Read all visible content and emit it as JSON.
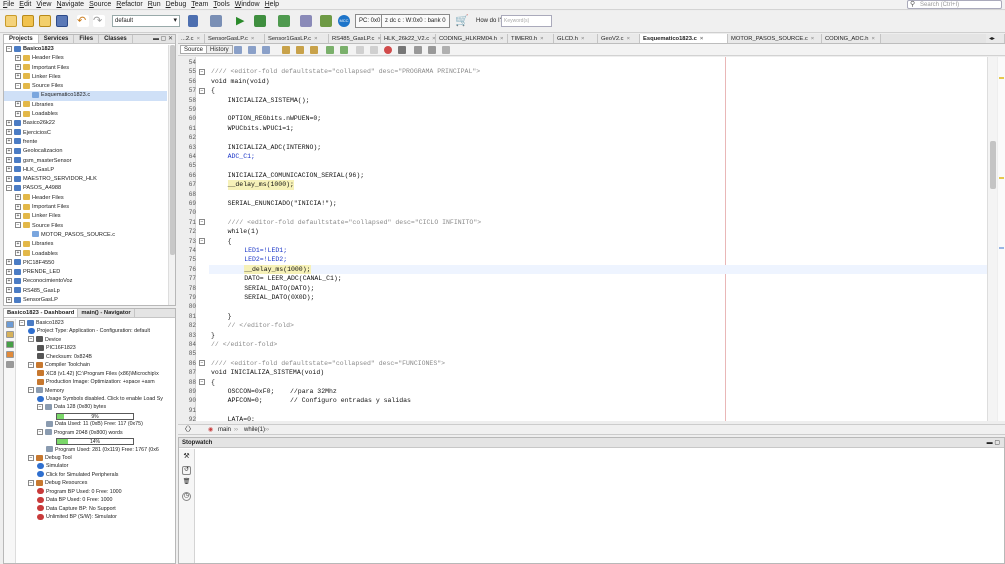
{
  "menu": [
    "File",
    "Edit",
    "View",
    "Navigate",
    "Source",
    "Refactor",
    "Run",
    "Debug",
    "Team",
    "Tools",
    "Window",
    "Help"
  ],
  "search_placeholder": "Search (Ctrl+I)",
  "toolbar": {
    "config_value": "default",
    "pc_label": "PC: 0x0",
    "status_bits": "z dc c  : W:0x0 : bank 0",
    "how_do_i": "How do I?",
    "keywords_placeholder": "Keyword(s)"
  },
  "projects": {
    "tabs": [
      "Projects",
      "Services",
      "Files",
      "Classes"
    ],
    "tree": [
      {
        "label": "Basico1823",
        "level": 0,
        "expanded": true,
        "bold": true,
        "icon": "project"
      },
      {
        "label": "Header Files",
        "level": 1,
        "expanded": false,
        "icon": "folder"
      },
      {
        "label": "Important Files",
        "level": 1,
        "expanded": false,
        "icon": "folder"
      },
      {
        "label": "Linker Files",
        "level": 1,
        "expanded": false,
        "icon": "folder"
      },
      {
        "label": "Source Files",
        "level": 1,
        "expanded": true,
        "icon": "folder"
      },
      {
        "label": "Esquematico1823.c",
        "level": 2,
        "icon": "file",
        "selected": true
      },
      {
        "label": "Libraries",
        "level": 1,
        "expanded": false,
        "icon": "folder"
      },
      {
        "label": "Loadables",
        "level": 1,
        "expanded": false,
        "icon": "folder"
      },
      {
        "label": "Basico26k22",
        "level": 0,
        "expanded": false,
        "icon": "project"
      },
      {
        "label": "EjerciciosC",
        "level": 0,
        "expanded": false,
        "icon": "project"
      },
      {
        "label": "frente",
        "level": 0,
        "expanded": false,
        "icon": "project"
      },
      {
        "label": "Geolocalizacion",
        "level": 0,
        "expanded": false,
        "icon": "project"
      },
      {
        "label": "gsm_masterSensor",
        "level": 0,
        "expanded": false,
        "icon": "project"
      },
      {
        "label": "HLK_GasLP",
        "level": 0,
        "expanded": false,
        "icon": "project"
      },
      {
        "label": "MAESTRO_SERVIDOR_HLK",
        "level": 0,
        "expanded": false,
        "icon": "project"
      },
      {
        "label": "PASOS_A4988",
        "level": 0,
        "expanded": true,
        "icon": "project"
      },
      {
        "label": "Header Files",
        "level": 1,
        "expanded": false,
        "icon": "folder"
      },
      {
        "label": "Important Files",
        "level": 1,
        "expanded": false,
        "icon": "folder"
      },
      {
        "label": "Linker Files",
        "level": 1,
        "expanded": false,
        "icon": "folder"
      },
      {
        "label": "Source Files",
        "level": 1,
        "expanded": true,
        "icon": "folder"
      },
      {
        "label": "MOTOR_PASOS_SOURCE.c",
        "level": 2,
        "icon": "file"
      },
      {
        "label": "Libraries",
        "level": 1,
        "expanded": false,
        "icon": "folder"
      },
      {
        "label": "Loadables",
        "level": 1,
        "expanded": false,
        "icon": "folder"
      },
      {
        "label": "PIC18F4550",
        "level": 0,
        "expanded": false,
        "icon": "project"
      },
      {
        "label": "PRENDE_LED",
        "level": 0,
        "expanded": false,
        "icon": "project"
      },
      {
        "label": "ReconocimientoVoz",
        "level": 0,
        "expanded": false,
        "icon": "project"
      },
      {
        "label": "RS485_GasLp",
        "level": 0,
        "expanded": false,
        "icon": "project"
      },
      {
        "label": "SensorGasLP",
        "level": 0,
        "expanded": false,
        "icon": "project"
      }
    ]
  },
  "dashboard": {
    "tabs": [
      "Basico1823 - Dashboard",
      "main() - Navigator"
    ],
    "rows": [
      {
        "label": "Basico1823",
        "level": 0,
        "toggle": "-",
        "icon": "project"
      },
      {
        "label": "Project Type: Application - Configuration: default",
        "level": 1,
        "icon": "info"
      },
      {
        "label": "Device",
        "level": 1,
        "toggle": "-",
        "icon": "chip"
      },
      {
        "label": "PIC16F1823",
        "level": 2,
        "icon": "chip"
      },
      {
        "label": "Checksum: 0x824B",
        "level": 2,
        "icon": "chip"
      },
      {
        "label": "Compiler Toolchain",
        "level": 1,
        "toggle": "-",
        "icon": "tool"
      },
      {
        "label": "XC8 (v1.42) [C:\\Program Files (x86)\\Microchip\\x",
        "level": 2,
        "icon": "tool"
      },
      {
        "label": "Production Image: Optimization: +space +asm",
        "level": 2,
        "icon": "tool"
      },
      {
        "label": "Memory",
        "level": 1,
        "toggle": "-",
        "icon": "mem"
      },
      {
        "label": "Usage Symbols disabled. Click to enable Load Sy",
        "level": 2,
        "icon": "info"
      },
      {
        "label": "Data 128 (0x80) bytes",
        "level": 2,
        "toggle": "-",
        "icon": "mem"
      },
      {
        "bar": true,
        "level": 3,
        "percent": 9,
        "text": "9%"
      },
      {
        "label": "Data Used: 11 (0xB) Free: 117 (0x75)",
        "level": 3,
        "icon": "mem"
      },
      {
        "label": "Program 2048 (0x800) words",
        "level": 2,
        "toggle": "-",
        "icon": "mem"
      },
      {
        "bar": true,
        "level": 3,
        "percent": 14,
        "text": "14%"
      },
      {
        "label": "Program Used: 281 (0x119) Free: 1767 (0x6",
        "level": 3,
        "icon": "mem"
      },
      {
        "label": "Debug Tool",
        "level": 1,
        "toggle": "-",
        "icon": "tool"
      },
      {
        "label": "Simulator",
        "level": 2,
        "icon": "info"
      },
      {
        "label": "Click for Simulated Peripherals",
        "level": 2,
        "icon": "info"
      },
      {
        "label": "Debug Resources",
        "level": 1,
        "toggle": "-",
        "icon": "tool"
      },
      {
        "label": "Program BP Used: 0  Free: 1000",
        "level": 2,
        "icon": "bp"
      },
      {
        "label": "Data BP Used: 0  Free: 1000",
        "level": 2,
        "icon": "bp"
      },
      {
        "label": "Data Capture BP: No Support",
        "level": 2,
        "icon": "bp"
      },
      {
        "label": "Unlimited BP (S/W): Simulator",
        "level": 2,
        "icon": "bp"
      }
    ]
  },
  "editor_tabs": [
    {
      "label": "...2.c",
      "w": 27
    },
    {
      "label": "SensorGasLP.c",
      "w": 60
    },
    {
      "label": "Sensor1GasLP.c",
      "w": 64
    },
    {
      "label": "RS485_GasLP.c",
      "w": 52
    },
    {
      "label": "HLK_26k22_V2.c",
      "w": 55
    },
    {
      "label": "CODING_HLKRM04.h",
      "w": 72
    },
    {
      "label": "TIMER0.h",
      "w": 46
    },
    {
      "label": "GLCD.h",
      "w": 44
    },
    {
      "label": "GeoV2.c",
      "w": 42
    },
    {
      "label": "Esquematico1823.c",
      "w": 88,
      "active": true
    },
    {
      "label": "MOTOR_PASOS_SOURCE.c",
      "w": 94
    },
    {
      "label": "CODING_ADC.h",
      "w": 59
    }
  ],
  "editor_toolbar": {
    "source": "Source",
    "history": "History"
  },
  "code": [
    {
      "n": "54",
      "text": ""
    },
    {
      "n": "55",
      "text": "//// <editor-fold defaultstate=\"collapsed\" desc=\"PROGRAMA PRINCIPAL\">",
      "cls": "cm",
      "fold": "-",
      "ind": 0
    },
    {
      "n": "56",
      "text": "void main(void)",
      "ind": 0
    },
    {
      "n": "57",
      "text": "{",
      "ind": 0,
      "fold": "-"
    },
    {
      "n": "58",
      "text": "INICIALIZA_SISTEMA();",
      "ind": 2
    },
    {
      "n": "59",
      "text": ""
    },
    {
      "n": "60",
      "text": "OPTION_REGbits.nWPUEN=0;",
      "ind": 2
    },
    {
      "n": "61",
      "text": "WPUCbits.WPUC1=1;",
      "ind": 2
    },
    {
      "n": "62",
      "text": ""
    },
    {
      "n": "63",
      "text": "INICIALIZA_ADC(INTERNO);",
      "ind": 2
    },
    {
      "n": "64",
      "text": "ADC_C1;",
      "ind": 2,
      "cls": "kwd"
    },
    {
      "n": "65",
      "text": ""
    },
    {
      "n": "66",
      "text": "INICIALIZA_COMUNICACION_SERIAL(96);",
      "ind": 2
    },
    {
      "n": "67",
      "text": "__delay_ms(1000);",
      "ind": 2,
      "cls": "ye"
    },
    {
      "n": "68",
      "text": ""
    },
    {
      "n": "69",
      "text": "SERIAL_ENUNCIADO(\"INICIA!\");",
      "ind": 2
    },
    {
      "n": "70",
      "text": ""
    },
    {
      "n": "71",
      "text": "//// <editor-fold defaultstate=\"collapsed\" desc=\"CICLO INFINITO\">",
      "ind": 2,
      "cls": "cm",
      "fold": "-"
    },
    {
      "n": "72",
      "text": "while(1)",
      "ind": 2
    },
    {
      "n": "73",
      "text": "{",
      "ind": 2,
      "fold": "-"
    },
    {
      "n": "74",
      "text": "LED1=!LED1;",
      "ind": 4,
      "cls": "kwd"
    },
    {
      "n": "75",
      "text": "LED2=!LED2;",
      "ind": 4,
      "cls": "kwd"
    },
    {
      "n": "76",
      "text": "__delay_ms(1000);",
      "ind": 4,
      "cls": "ye",
      "hl": true
    },
    {
      "n": "77",
      "text": "DATO= LEER_ADC(CANAL_C1);",
      "ind": 4
    },
    {
      "n": "78",
      "text": "SERIAL_DATO(DATO);",
      "ind": 4
    },
    {
      "n": "79",
      "text": "SERIAL_DATO(0X0D);",
      "ind": 4
    },
    {
      "n": "80",
      "text": ""
    },
    {
      "n": "81",
      "text": "}",
      "ind": 2
    },
    {
      "n": "82",
      "text": "// </editor-fold>",
      "ind": 2,
      "cls": "cm"
    },
    {
      "n": "83",
      "text": "}",
      "ind": 0
    },
    {
      "n": "84",
      "text": "// </editor-fold>",
      "ind": 0,
      "cls": "cm"
    },
    {
      "n": "85",
      "text": ""
    },
    {
      "n": "86",
      "text": "//// <editor-fold defaultstate=\"collapsed\" desc=\"FUNCIONES\">",
      "ind": 0,
      "cls": "cm",
      "fold": "-"
    },
    {
      "n": "87",
      "text": "void INICIALIZA_SISTEMA(void)",
      "ind": 0
    },
    {
      "n": "88",
      "text": "{",
      "ind": 0,
      "fold": "-"
    },
    {
      "n": "89",
      "text": "OSCCON=0xF0;    //para 32Mhz",
      "ind": 2
    },
    {
      "n": "90",
      "text": "APFCON=0;       // Configuro entradas y salidas",
      "ind": 2
    },
    {
      "n": "91",
      "text": ""
    },
    {
      "n": "92",
      "text": "LATA=0;",
      "ind": 2
    }
  ],
  "breadcrumb": {
    "main": "main",
    "loop": "while(1)"
  },
  "stopwatch": {
    "title": "Stopwatch"
  }
}
